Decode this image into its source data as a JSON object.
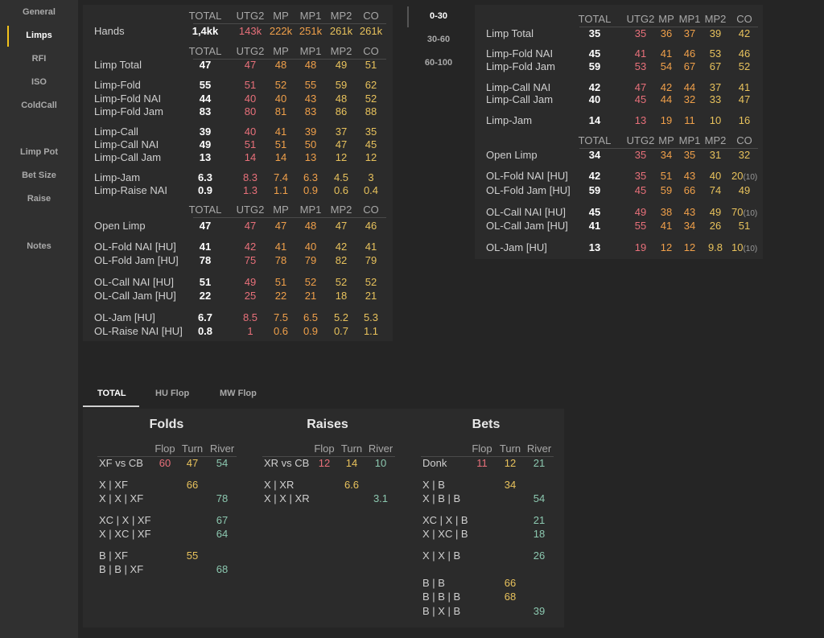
{
  "sidebar": {
    "items": [
      {
        "label": "General",
        "active": false
      },
      {
        "label": "Limps",
        "active": true
      },
      {
        "label": "RFI",
        "active": false
      },
      {
        "label": "ISO",
        "active": false
      },
      {
        "label": "ColdCall",
        "active": false
      },
      {
        "label": "Limp Pot",
        "active": false
      },
      {
        "label": "Bet Size",
        "active": false
      },
      {
        "label": "Raise",
        "active": false
      },
      {
        "label": "Notes",
        "active": false
      }
    ]
  },
  "range_tabs": [
    {
      "label": "0-30",
      "active": true
    },
    {
      "label": "30-60",
      "active": false
    },
    {
      "label": "60-100",
      "active": false
    }
  ],
  "left_table": {
    "headers": [
      "TOTAL",
      "UTG2",
      "MP",
      "MP1",
      "MP2",
      "CO"
    ],
    "hands": {
      "label": "Hands",
      "values": [
        "1,4kk",
        "143k",
        "222k",
        "251k",
        "261k",
        "261k"
      ]
    },
    "limp": [
      {
        "label": "Limp Total",
        "values": [
          "47",
          "47",
          "48",
          "48",
          "49",
          "51"
        ]
      },
      {
        "label": "Limp-Fold",
        "values": [
          "55",
          "51",
          "52",
          "55",
          "59",
          "62"
        ]
      },
      {
        "label": "Limp-Fold  NAI",
        "values": [
          "44",
          "40",
          "40",
          "43",
          "48",
          "52"
        ]
      },
      {
        "label": "Limp-Fold  Jam",
        "values": [
          "83",
          "80",
          "81",
          "83",
          "86",
          "88"
        ]
      },
      {
        "label": "Limp-Call",
        "values": [
          "39",
          "40",
          "41",
          "39",
          "37",
          "35"
        ]
      },
      {
        "label": "Limp-Call  NAI",
        "values": [
          "49",
          "51",
          "51",
          "50",
          "47",
          "45"
        ]
      },
      {
        "label": "Limp-Call  Jam",
        "values": [
          "13",
          "14",
          "14",
          "13",
          "12",
          "12"
        ]
      },
      {
        "label": "Limp-Jam",
        "values": [
          "6.3",
          "8.3",
          "7.4",
          "6.3",
          "4.5",
          "3"
        ]
      },
      {
        "label": "Limp-Raise NAI",
        "values": [
          "0.9",
          "1.3",
          "1.1",
          "0.9",
          "0.6",
          "0.4"
        ]
      }
    ],
    "open_limp": [
      {
        "label": "Open Limp",
        "values": [
          "47",
          "47",
          "47",
          "48",
          "47",
          "46"
        ]
      },
      {
        "label": "OL-Fold NAI [HU]",
        "values": [
          "41",
          "42",
          "41",
          "40",
          "42",
          "41"
        ]
      },
      {
        "label": "OL-Fold Jam [HU]",
        "values": [
          "78",
          "75",
          "78",
          "79",
          "82",
          "79"
        ]
      },
      {
        "label": "OL-Call NAI [HU]",
        "values": [
          "51",
          "49",
          "51",
          "52",
          "52",
          "52"
        ]
      },
      {
        "label": "OL-Call Jam [HU]",
        "values": [
          "22",
          "25",
          "22",
          "21",
          "18",
          "21"
        ]
      },
      {
        "label": "OL-Jam [HU]",
        "values": [
          "6.7",
          "8.5",
          "7.5",
          "6.5",
          "5.2",
          "5.3"
        ]
      },
      {
        "label": "OL-Raise NAI [HU]",
        "values": [
          "0.8",
          "1",
          "0.6",
          "0.9",
          "0.7",
          "1.1"
        ]
      }
    ]
  },
  "right_table": {
    "headers": [
      "TOTAL",
      "UTG2",
      "MP",
      "MP1",
      "MP2",
      "CO"
    ],
    "limp": [
      {
        "label": "Limp Total",
        "values": [
          "35",
          "35",
          "36",
          "37",
          "39",
          "42"
        ]
      },
      {
        "label": "Limp-Fold  NAI",
        "values": [
          "45",
          "41",
          "41",
          "46",
          "53",
          "46"
        ]
      },
      {
        "label": "Limp-Fold  Jam",
        "values": [
          "59",
          "53",
          "54",
          "67",
          "67",
          "52"
        ]
      },
      {
        "label": "Limp-Call  NAI",
        "values": [
          "42",
          "47",
          "42",
          "44",
          "37",
          "41"
        ]
      },
      {
        "label": "Limp-Call  Jam",
        "values": [
          "40",
          "45",
          "44",
          "32",
          "33",
          "47"
        ]
      },
      {
        "label": "Limp-Jam",
        "values": [
          "14",
          "13",
          "19",
          "11",
          "10",
          "16"
        ]
      }
    ],
    "open_limp": [
      {
        "label": "Open Limp",
        "values": [
          "34",
          "35",
          "34",
          "35",
          "31",
          "32"
        ]
      },
      {
        "label": "OL-Fold NAI [HU]",
        "values": [
          "42",
          "35",
          "51",
          "43",
          "40",
          "20"
        ],
        "co_sample": "(10)"
      },
      {
        "label": "OL-Fold Jam [HU]",
        "values": [
          "59",
          "45",
          "59",
          "66",
          "74",
          "49"
        ]
      },
      {
        "label": "OL-Call NAI [HU]",
        "values": [
          "45",
          "49",
          "38",
          "43",
          "49",
          "70"
        ],
        "co_sample": "(10)"
      },
      {
        "label": "OL-Call Jam [HU]",
        "values": [
          "41",
          "55",
          "41",
          "34",
          "26",
          "51"
        ]
      },
      {
        "label": "OL-Jam [HU]",
        "values": [
          "13",
          "19",
          "12",
          "12",
          "9.8",
          "10"
        ],
        "co_sample": "(10)"
      }
    ]
  },
  "bottom_tabs": [
    {
      "label": "TOTAL",
      "active": true
    },
    {
      "label": "HU Flop",
      "active": false
    },
    {
      "label": "MW Flop",
      "active": false
    }
  ],
  "postflop": {
    "street_headers": [
      "Flop",
      "Turn",
      "River"
    ],
    "folds": {
      "title": "Folds",
      "rows": [
        {
          "label": "XF vs CB",
          "flop": "60",
          "turn": "47",
          "river": "54"
        },
        {
          "label": "X | XF",
          "flop": "",
          "turn": "66",
          "river": ""
        },
        {
          "label": "X | X | XF",
          "flop": "",
          "turn": "",
          "river": "78"
        },
        {
          "label": "XC | X | XF",
          "flop": "",
          "turn": "",
          "river": "67"
        },
        {
          "label": "X | XC | XF",
          "flop": "",
          "turn": "",
          "river": "64"
        },
        {
          "label": "B | XF",
          "flop": "",
          "turn": "55",
          "river": ""
        },
        {
          "label": "B | B | XF",
          "flop": "",
          "turn": "",
          "river": "68"
        }
      ]
    },
    "raises": {
      "title": "Raises",
      "rows": [
        {
          "label": "XR vs CB",
          "flop": "12",
          "turn": "14",
          "river": "10"
        },
        {
          "label": "X | XR",
          "flop": "",
          "turn": "6.6",
          "river": ""
        },
        {
          "label": "X | X | XR",
          "flop": "",
          "turn": "",
          "river": "3.1"
        }
      ]
    },
    "bets": {
      "title": "Bets",
      "rows": [
        {
          "label": "Donk",
          "flop": "11",
          "turn": "12",
          "river": "21"
        },
        {
          "label": "X | B",
          "flop": "",
          "turn": "34",
          "river": ""
        },
        {
          "label": "X | B | B",
          "flop": "",
          "turn": "",
          "river": "54"
        },
        {
          "label": "XC | X | B",
          "flop": "",
          "turn": "",
          "river": "21"
        },
        {
          "label": "X | XC | B",
          "flop": "",
          "turn": "",
          "river": "18"
        },
        {
          "label": "X | X | B",
          "flop": "",
          "turn": "",
          "river": "26"
        },
        {
          "label": "B | B",
          "flop": "",
          "turn": "66",
          "river": ""
        },
        {
          "label": "B | B | B",
          "flop": "",
          "turn": "68",
          "river": ""
        },
        {
          "label": "B | X | B",
          "flop": "",
          "turn": "",
          "river": "39"
        }
      ]
    }
  },
  "colors": {
    "accent": "#f2c21b",
    "red": "#e8707a",
    "orange": "#f0a04a",
    "yellow": "#e8c25c",
    "green": "#8cc8b0"
  }
}
